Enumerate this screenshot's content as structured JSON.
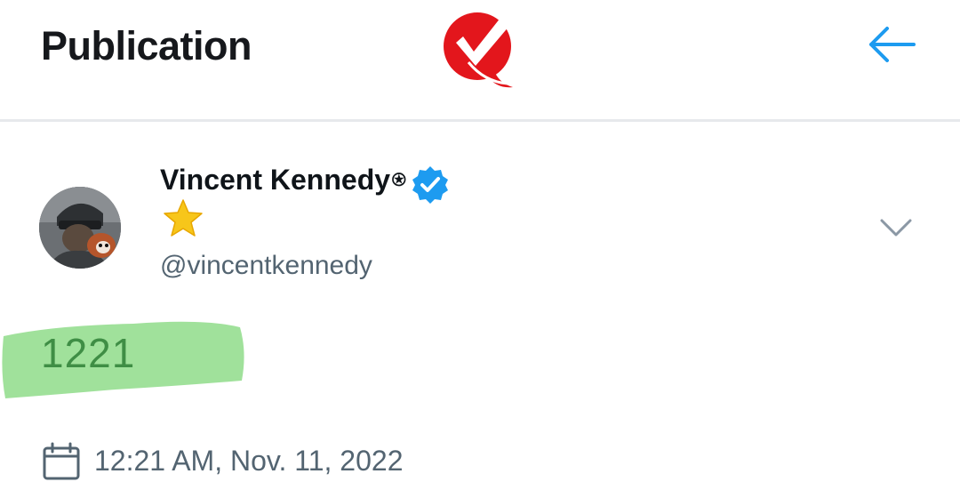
{
  "header": {
    "title": "Publication",
    "logo_icon": "red-checkmark-logo",
    "back_icon": "arrow-left-icon"
  },
  "post": {
    "author": {
      "display_name": "Vincent Kennedy",
      "name_symbol": "⍟",
      "verified": true,
      "badge_emoji": "⭐",
      "handle": "@vincentkennedy"
    },
    "text": "1221",
    "timestamp": "12:21 AM, Nov. 11, 2022"
  },
  "colors": {
    "accent": "#1d9bf0",
    "logo_red": "#e3161c",
    "highlight_green": "#8fdc8a",
    "post_text_green": "#3f8e45",
    "secondary_text": "#536471",
    "star_yellow": "#f7c61a"
  }
}
